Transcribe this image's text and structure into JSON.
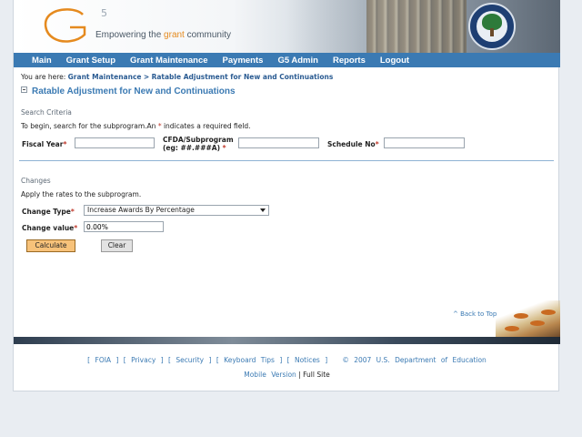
{
  "header": {
    "logo_main": "G",
    "logo_super": "5",
    "tagline_pre": "Empowering the ",
    "tagline_highlight": "grant",
    "tagline_post": " community"
  },
  "nav": {
    "items": [
      "Main",
      "Grant Setup",
      "Grant Maintenance",
      "Payments",
      "G5 Admin",
      "Reports",
      "Logout"
    ]
  },
  "breadcrumb": {
    "prefix": "You are here:",
    "parent": "Grant Maintenance",
    "separator": ">",
    "current": "Ratable Adjustment for New and Continuations"
  },
  "page_title": "Ratable Adjustment for New and Continuations",
  "search": {
    "section_label": "Search Criteria",
    "help_text": "To begin, search for the subprogram.An",
    "help_text_end": "indicates a required field.",
    "fiscal_year_label": "Fiscal Year",
    "fiscal_year_value": "",
    "cfda_label_line1": "CFDA/Subprogram",
    "cfda_label_line2": "(eg: ##.###A)",
    "cfda_value": "",
    "schedule_label": "Schedule No",
    "schedule_value": "",
    "required_marker": "*"
  },
  "changes": {
    "section_label": "Changes",
    "help_text": "Apply the rates to the subprogram.",
    "change_type_label": "Change Type",
    "change_type_selected": "Increase Awards By Percentage",
    "change_value_label": "Change value",
    "change_value": "0.00%",
    "calculate_label": "Calculate",
    "clear_label": "Clear"
  },
  "back_to_top": "^ Back to Top",
  "footer": {
    "links": [
      "FOIA",
      "Privacy",
      "Security",
      "Keyboard Tips",
      "Notices"
    ],
    "copyright": "© 2007 U.S. Department of Education",
    "mobile_label": "Mobile Version",
    "divider": "|",
    "full_label": "Full Site"
  },
  "colors": {
    "nav_bg": "#3b7ab3",
    "title": "#3b7ab3",
    "accent_orange": "#e58a1f",
    "required": "#c0392b",
    "calculate_bg": "#f7c27a"
  }
}
